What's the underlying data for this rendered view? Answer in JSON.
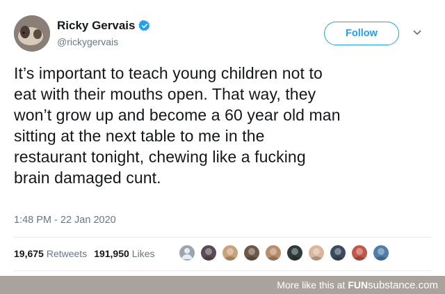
{
  "tweet": {
    "author_name": "Ricky Gervais",
    "handle": "@rickygervais",
    "follow_label": "Follow",
    "text": "It’s important to teach young children not to\neat with their mouths open. That way, they\nwon’t grow up and become a 60 year old man\nsitting at the next table to me in the\nrestaurant tonight, chewing like a fucking\nbrain damaged cunt.",
    "timestamp": "1:48 PM - 22 Jan 2020",
    "retweets_count": "19,675",
    "retweets_label": "Retweets",
    "likes_count": "191,950",
    "likes_label": "Likes"
  },
  "likers": [
    {
      "icon": "avatar-default-icon",
      "color": "#9aa5b1"
    },
    {
      "icon": "avatar-icon",
      "color": "#5a4a54"
    },
    {
      "icon": "avatar-icon",
      "color": "#c9a27a"
    },
    {
      "icon": "avatar-icon",
      "color": "#6d5847"
    },
    {
      "icon": "avatar-icon",
      "color": "#b88d6a"
    },
    {
      "icon": "avatar-icon",
      "color": "#2f3b3a"
    },
    {
      "icon": "avatar-icon",
      "color": "#d9b59a"
    },
    {
      "icon": "avatar-icon",
      "color": "#3c4a5e"
    },
    {
      "icon": "avatar-icon",
      "color": "#c2584b"
    },
    {
      "icon": "avatar-icon",
      "color": "#4f7fa8"
    }
  ],
  "footer": {
    "more_text": "More like this at",
    "brand_fun": "FUN",
    "brand_rest": "substance.com"
  },
  "colors": {
    "accent": "#1da1f2",
    "footer_bg": "#aaa39d"
  }
}
